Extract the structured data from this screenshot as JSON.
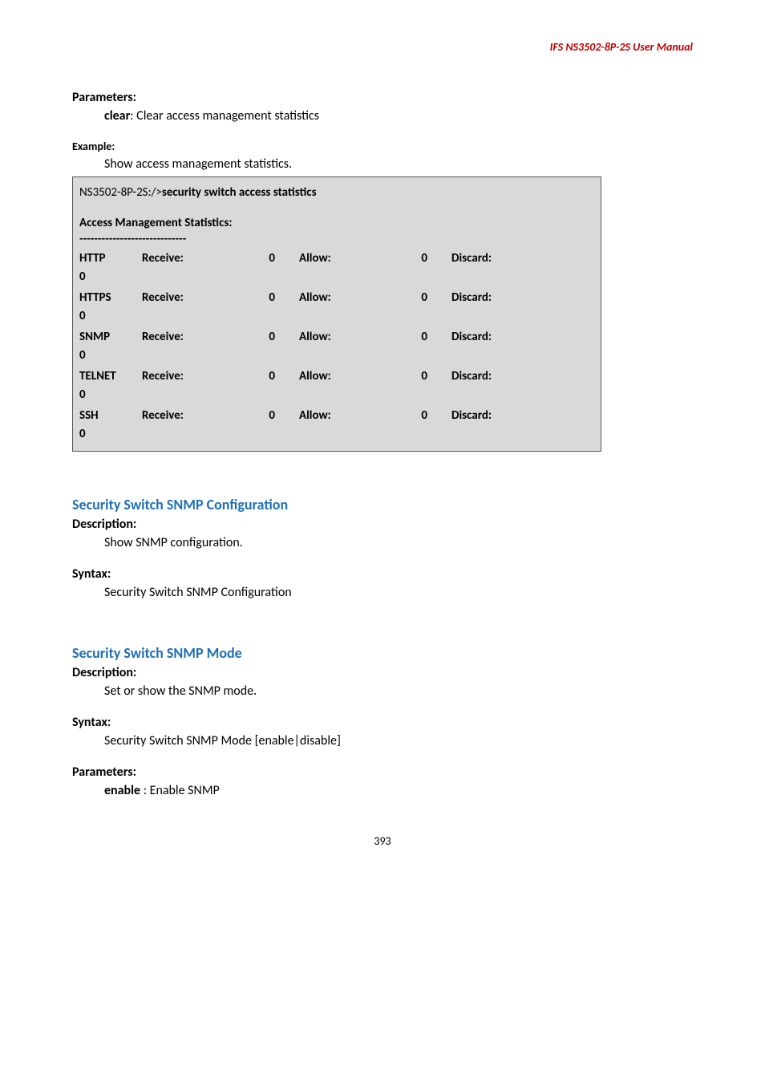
{
  "header": {
    "doc_title": "IFS  NS3502-8P-2S   User  Manual"
  },
  "parameters_section": {
    "label": "Parameters:",
    "param_name": "clear",
    "param_desc": ": Clear access management statistics"
  },
  "example_section": {
    "label": "Example:",
    "desc": "Show access management statistics."
  },
  "statsbox": {
    "prompt": "NS3502-8P-2S:/>",
    "command": "security switch access statistics",
    "title": "Access Management Statistics:",
    "dashes": "-----------------------------",
    "rows": [
      {
        "proto": "HTTP",
        "rlabel": "Receive:",
        "rval": "0",
        "alabel": "Allow:",
        "aval": "0",
        "dlabel": "Discard:",
        "dval": "0"
      },
      {
        "proto": "HTTPS",
        "rlabel": "Receive:",
        "rval": "0",
        "alabel": "Allow:",
        "aval": "0",
        "dlabel": "Discard:",
        "dval": "0"
      },
      {
        "proto": "SNMP",
        "rlabel": "Receive:",
        "rval": "0",
        "alabel": "Allow:",
        "aval": "0",
        "dlabel": "Discard:",
        "dval": "0"
      },
      {
        "proto": "TELNET",
        "rlabel": "Receive:",
        "rval": "0",
        "alabel": "Allow:",
        "aval": "0",
        "dlabel": "Discard:",
        "dval": "0"
      },
      {
        "proto": "SSH",
        "rlabel": "Receive:",
        "rval": "0",
        "alabel": "Allow:",
        "aval": "0",
        "dlabel": "Discard:",
        "dval": "0"
      }
    ]
  },
  "snmp_config": {
    "heading": "Security Switch SNMP Configuration",
    "desc_label": "Description:",
    "desc_text": "Show SNMP configuration.",
    "syntax_label": "Syntax:",
    "syntax_text": "Security Switch SNMP Configuration"
  },
  "snmp_mode": {
    "heading": "Security Switch SNMP Mode",
    "desc_label": "Description:",
    "desc_text": "Set or show the SNMP mode.",
    "syntax_label": "Syntax:",
    "syntax_text": "Security Switch SNMP Mode [enable|disable]",
    "params_label": "Parameters:",
    "param_name": "enable",
    "param_desc": " : Enable SNMP"
  },
  "footer": {
    "page_number": "393"
  }
}
